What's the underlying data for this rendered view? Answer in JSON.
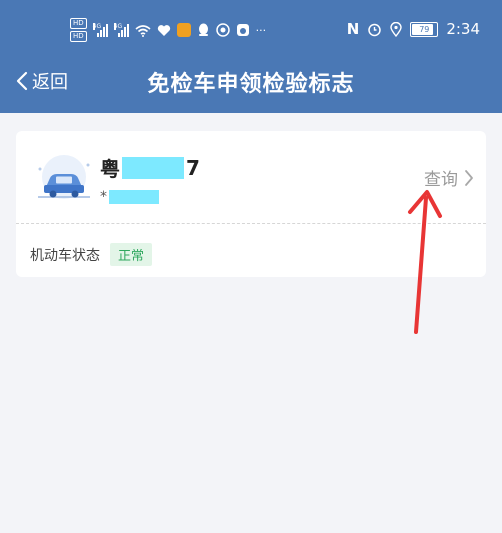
{
  "status_bar": {
    "hd_top": "HD",
    "hd_bottom": "HD",
    "signal_1": "4G",
    "signal_2": "4G",
    "more": "···",
    "nfc": "N",
    "battery_level": "79",
    "time": "2:34"
  },
  "nav": {
    "back_label": "返回",
    "title": "免检车申领检验标志"
  },
  "vehicle": {
    "plate_prefix": "粤",
    "plate_suffix": "7",
    "sub_prefix": "*",
    "query_label": "查询",
    "status_label": "机动车状态",
    "status_value": "正常"
  },
  "colors": {
    "header_bg": "#4a78b5",
    "mask": "#7de9ff",
    "status_green": "#2fa85e",
    "arrow_red": "#e83535"
  }
}
